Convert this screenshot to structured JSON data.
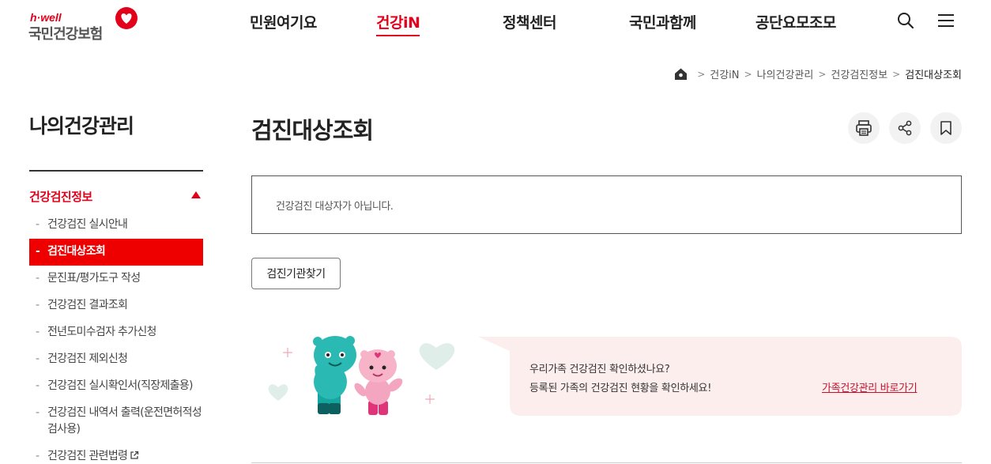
{
  "logo": {
    "small": "h·well",
    "main": "국민건강보험"
  },
  "gnb": {
    "items": [
      {
        "label": "민원여기요"
      },
      {
        "label": "건강iN"
      },
      {
        "label": "정책센터"
      },
      {
        "label": "국민과함께"
      },
      {
        "label": "공단요모조모"
      }
    ],
    "active": "건강iN",
    "icons": [
      "search-icon",
      "menu-icon"
    ]
  },
  "breadcrumb": {
    "items": [
      "건강iN",
      "나의건강관리",
      "건강검진정보",
      "검진대상조회"
    ]
  },
  "sidebar": {
    "title": "나의건강관리",
    "category": "건강검진정보",
    "items": [
      {
        "label": "건강검진 실시안내"
      },
      {
        "label": "검진대상조회"
      },
      {
        "label": "문진표/평가도구 작성"
      },
      {
        "label": "건강검진 결과조회"
      },
      {
        "label": "전년도미수검자 추가신청"
      },
      {
        "label": "건강검진 제외신청"
      },
      {
        "label": "건강검진 실시확인서(직장제출용)"
      },
      {
        "label": "건강검진 내역서 출력(운전면허적성검사용)"
      },
      {
        "label": "건강검진 관련법령"
      }
    ]
  },
  "main": {
    "title": "검진대상조회",
    "tools": [
      "print-icon",
      "share-icon",
      "bookmark-icon"
    ],
    "notice": "건강검진 대상자가 아닙니다.",
    "search_button": "검진기관찾기",
    "banner": {
      "line1": "우리가족 건강검진 확인하셨나요?",
      "line2": "등록된 가족의 건강검진 현황을 확인하세요!",
      "link": "가족건강관리 바로가기"
    }
  },
  "colors": {
    "accent": "#e3001b",
    "active_bg": "#ee0000",
    "bubble_bg": "#fdeeee"
  }
}
